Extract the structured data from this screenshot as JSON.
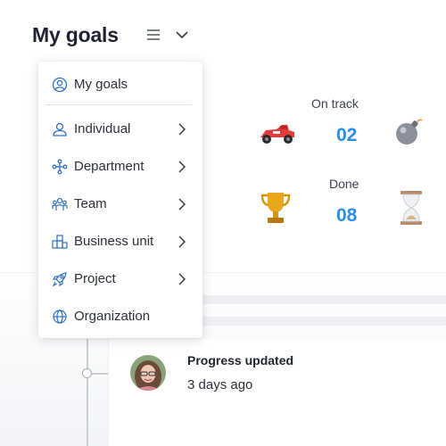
{
  "header": {
    "title": "My goals",
    "icons": [
      "menu-icon",
      "chevron-down-icon"
    ]
  },
  "stats": [
    {
      "label": "On track",
      "value": "02",
      "left_icon": "race-car-icon",
      "right_icon": "bomb-icon"
    },
    {
      "label": "Done",
      "value": "08",
      "left_icon": "trophy-icon",
      "right_icon": "hourglass-icon"
    }
  ],
  "activity": {
    "title": "Progress updated",
    "time": "3 days ago"
  },
  "menu": {
    "items": [
      {
        "label": "My goals",
        "icon": "user-circle-icon",
        "has_submenu": false
      },
      {
        "label": "Individual",
        "icon": "user-icon",
        "has_submenu": true
      },
      {
        "label": "Department",
        "icon": "department-icon",
        "has_submenu": true
      },
      {
        "label": "Team",
        "icon": "team-icon",
        "has_submenu": true
      },
      {
        "label": "Business unit",
        "icon": "business-unit-icon",
        "has_submenu": true
      },
      {
        "label": "Project",
        "icon": "rocket-icon",
        "has_submenu": true
      },
      {
        "label": "Organization",
        "icon": "globe-icon",
        "has_submenu": false
      }
    ]
  },
  "colors": {
    "accent": "#2a8de8",
    "icon_blue": "#2f6fc2",
    "text": "#2b2f3a"
  }
}
